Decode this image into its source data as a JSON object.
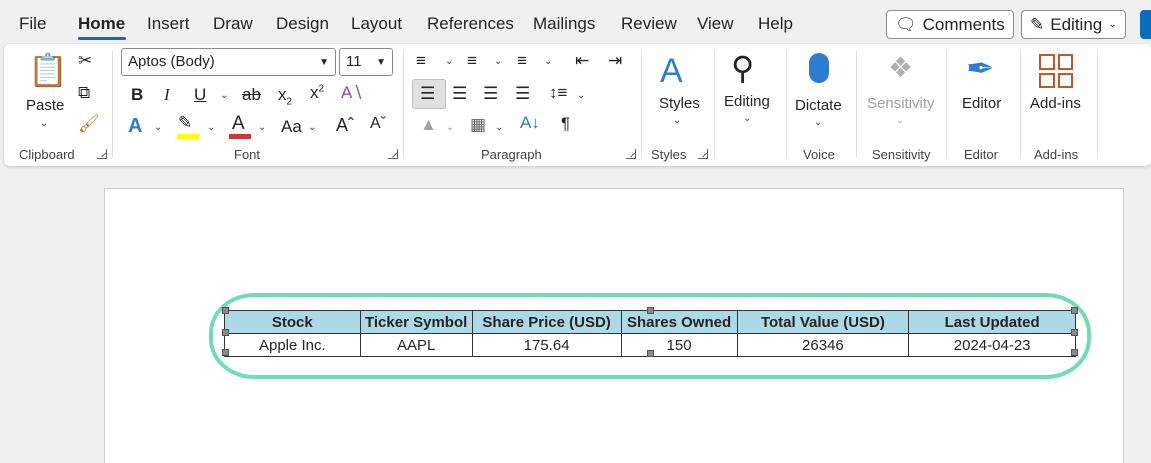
{
  "menu": {
    "tabs": [
      "File",
      "Home",
      "Insert",
      "Draw",
      "Design",
      "Layout",
      "References",
      "Mailings",
      "Review",
      "View",
      "Help"
    ],
    "comments_label": "Comments",
    "editing_label": "Editing"
  },
  "ribbon": {
    "clipboard": {
      "group_label": "Clipboard",
      "paste_label": "Paste"
    },
    "font": {
      "group_label": "Font",
      "font_name": "Aptos (Body)",
      "font_size": "11"
    },
    "paragraph": {
      "group_label": "Paragraph"
    },
    "styles": {
      "group_label": "Styles",
      "styles_label": "Styles"
    },
    "editing": {
      "editing_label": "Editing"
    },
    "voice": {
      "group_label": "Voice",
      "dictate_label": "Dictate"
    },
    "sensitivity": {
      "group_label": "Sensitivity",
      "sensitivity_label": "Sensitivity"
    },
    "editor": {
      "group_label": "Editor",
      "editor_label": "Editor"
    },
    "addins": {
      "group_label": "Add-ins",
      "addins_label": "Add-ins"
    }
  },
  "table": {
    "headers": [
      "Stock",
      "Ticker Symbol",
      "Share Price (USD)",
      "Shares Owned",
      "Total Value (USD)",
      "Last Updated"
    ],
    "rows": [
      [
        "Apple Inc.",
        "AAPL",
        "175.64",
        "150",
        "26346",
        "2024-04-23"
      ]
    ]
  },
  "colors": {
    "accent": "#0f6cbd",
    "header_fill": "#add8e6",
    "highlight_ring": "#6fdcb4",
    "font_color_bar": "#d13438",
    "highlight_bar": "#ffff00"
  }
}
